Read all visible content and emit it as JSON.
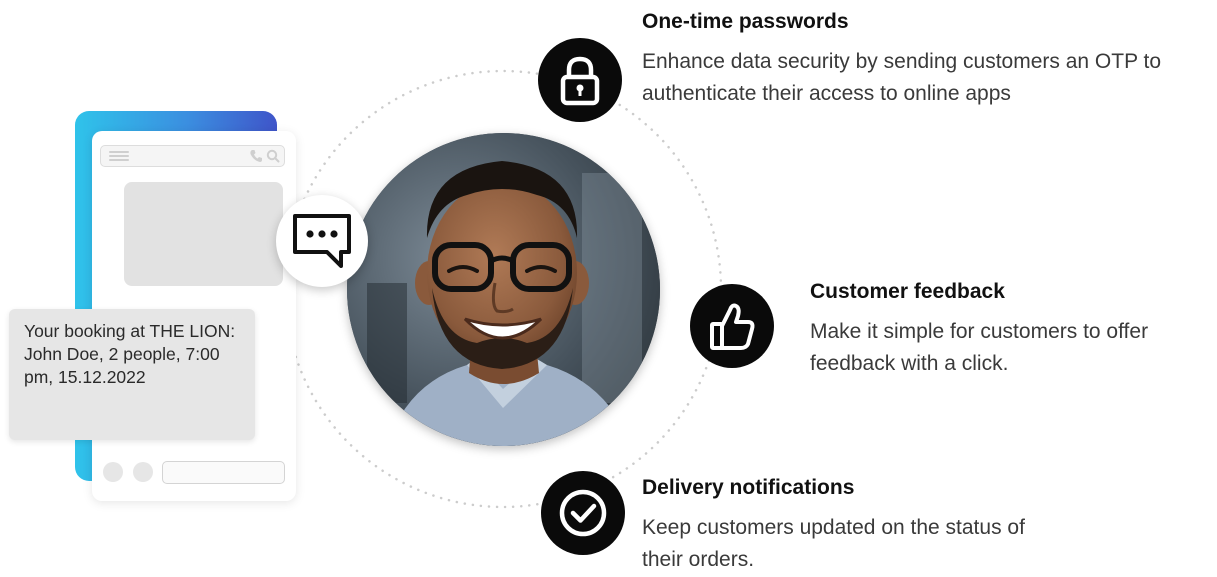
{
  "features": [
    {
      "title": "One-time passwords",
      "description": "Enhance data security by sending customers an OTP to authenticate their access to online apps",
      "icon": "lock-icon"
    },
    {
      "title": "Customer feedback",
      "description": "Make it simple for customers to offer feedback with a click.",
      "icon": "thumbs-up-icon"
    },
    {
      "title": "Delivery notifications",
      "description": "Keep customers updated on the status of their orders.",
      "icon": "check-circle-icon"
    }
  ],
  "phone": {
    "message": "Your booking at THE LION: John Doe, 2 people, 7:00 pm, 15.12.2022"
  },
  "colors": {
    "accent_gradient_start": "#2fc3ea",
    "accent_gradient_end": "#3f55c9",
    "icon_bg": "#0a0a0a",
    "bubble_gray": "#e6e6e6"
  }
}
